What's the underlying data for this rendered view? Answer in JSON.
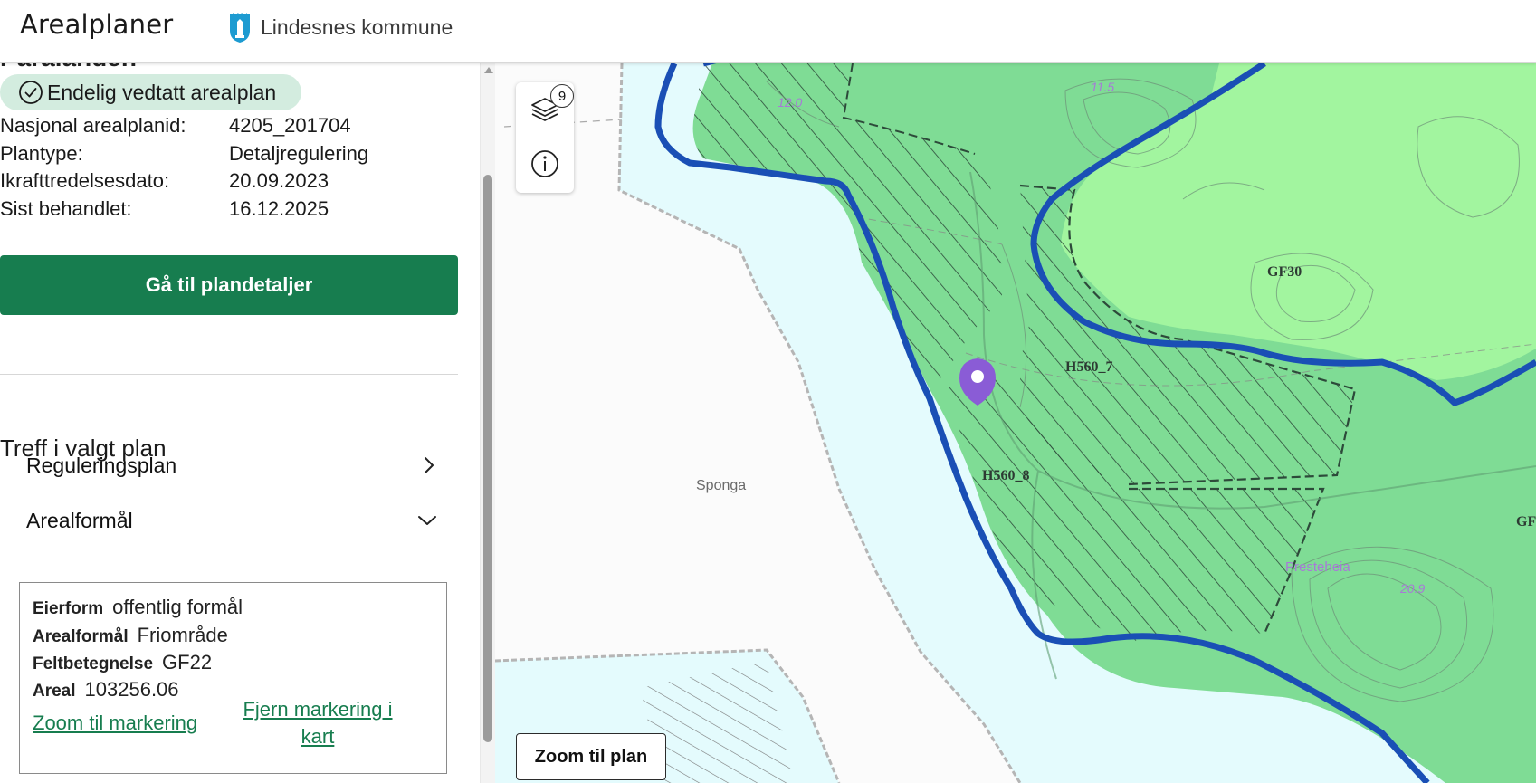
{
  "header": {
    "app_title": "Arealplaner",
    "municipality": "Lindesnes kommune"
  },
  "panel": {
    "cut_heading": "Paralanden",
    "status": "Endelig vedtatt arealplan",
    "meta": [
      {
        "key": "Nasjonal arealplanid:",
        "value": "4205_201704"
      },
      {
        "key": "Plantype:",
        "value": "Detaljregulering"
      },
      {
        "key": "Ikrafttredelsesdato:",
        "value": "20.09.2023"
      },
      {
        "key": "Sist behandlet:",
        "value": "16.12.2025"
      }
    ],
    "cta_label": "Gå til plandetaljer",
    "section_title": "Treff i valgt plan",
    "accordions": [
      {
        "label": "Reguleringsplan",
        "state": "collapsed"
      },
      {
        "label": "Arealformål",
        "state": "expanded"
      }
    ],
    "details": {
      "eierform_key": "Eierform",
      "eierform_value": "offentlig formål",
      "arealformal_key": "Arealformål",
      "arealformal_value": "Friområde",
      "feltbetegnelse_key": "Feltbetegnelse",
      "feltbetegnelse_value": "GF22",
      "areal_key": "Areal",
      "areal_value": "103256.06"
    },
    "zoom_link": "Zoom til markering",
    "remove_link_line1": "Fjern markering i",
    "remove_link_line2": "kart"
  },
  "map": {
    "layers_count": "9",
    "zoom_plan_label": "Zoom til plan",
    "labels": {
      "sponga": "Sponga",
      "gf30": "GF30",
      "h560_7": "H560_7",
      "h560_8": "H560_8",
      "presteheia": "Presteheia",
      "elev_115": "11.5",
      "elev_120": "12.0",
      "elev_209": "20.9",
      "gf_cut": "GF"
    },
    "colors": {
      "plan_border": "#1a4fb5",
      "friomrade": "#7fdc95",
      "light_green": "#a2f59f",
      "water": "#e4fbfd",
      "marker": "#8a5cd6",
      "brand_green": "#177d4f"
    }
  }
}
